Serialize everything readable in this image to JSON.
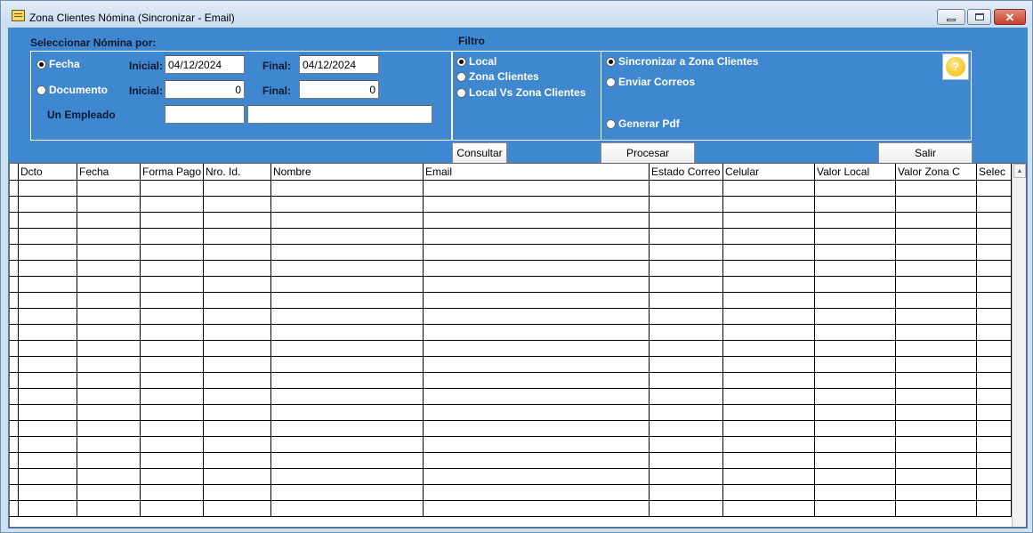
{
  "window": {
    "title": "Zona Clientes Nómina (Sincronizar - Email)",
    "controls": {
      "minimize": "minimize",
      "maximize": "maximize",
      "close": "✕"
    }
  },
  "seleccion": {
    "heading": "Seleccionar Nómina por:",
    "fecha_option": "Fecha",
    "documento_option": "Documento",
    "selected": "Fecha",
    "inicial_label": "Inicial:",
    "final_label": "Final:",
    "fecha_inicial": "04/12/2024",
    "fecha_final": "04/12/2024",
    "doc_inicial": "0",
    "doc_final": "0",
    "empleado_label": "Un Empleado",
    "empleado_code": "",
    "empleado_name": ""
  },
  "filtro": {
    "heading": "Filtro",
    "options": [
      "Local",
      "Zona Clientes",
      "Local Vs Zona Clientes"
    ],
    "selected": "Local"
  },
  "accion": {
    "options": [
      "Sincronizar a Zona Clientes",
      "Enviar Correos",
      "Generar Pdf"
    ],
    "selected": "Sincronizar a Zona Clientes",
    "help_icon": "help-icon",
    "help_glyph": "?"
  },
  "buttons": {
    "consultar": "Consultar",
    "procesar": "Procesar",
    "salir": "Salir"
  },
  "grid": {
    "columns": [
      "Dcto",
      "Fecha",
      "Forma Pago",
      "Nro. Id.",
      "Nombre",
      "Email",
      "Estado Correo",
      "Celular",
      "Valor Local",
      "Valor Zona C",
      "Selec"
    ],
    "rows": []
  },
  "colors": {
    "panel_bg": "#3f88d0",
    "titlebar": "#c9dcef",
    "close_button": "#c4402c"
  }
}
